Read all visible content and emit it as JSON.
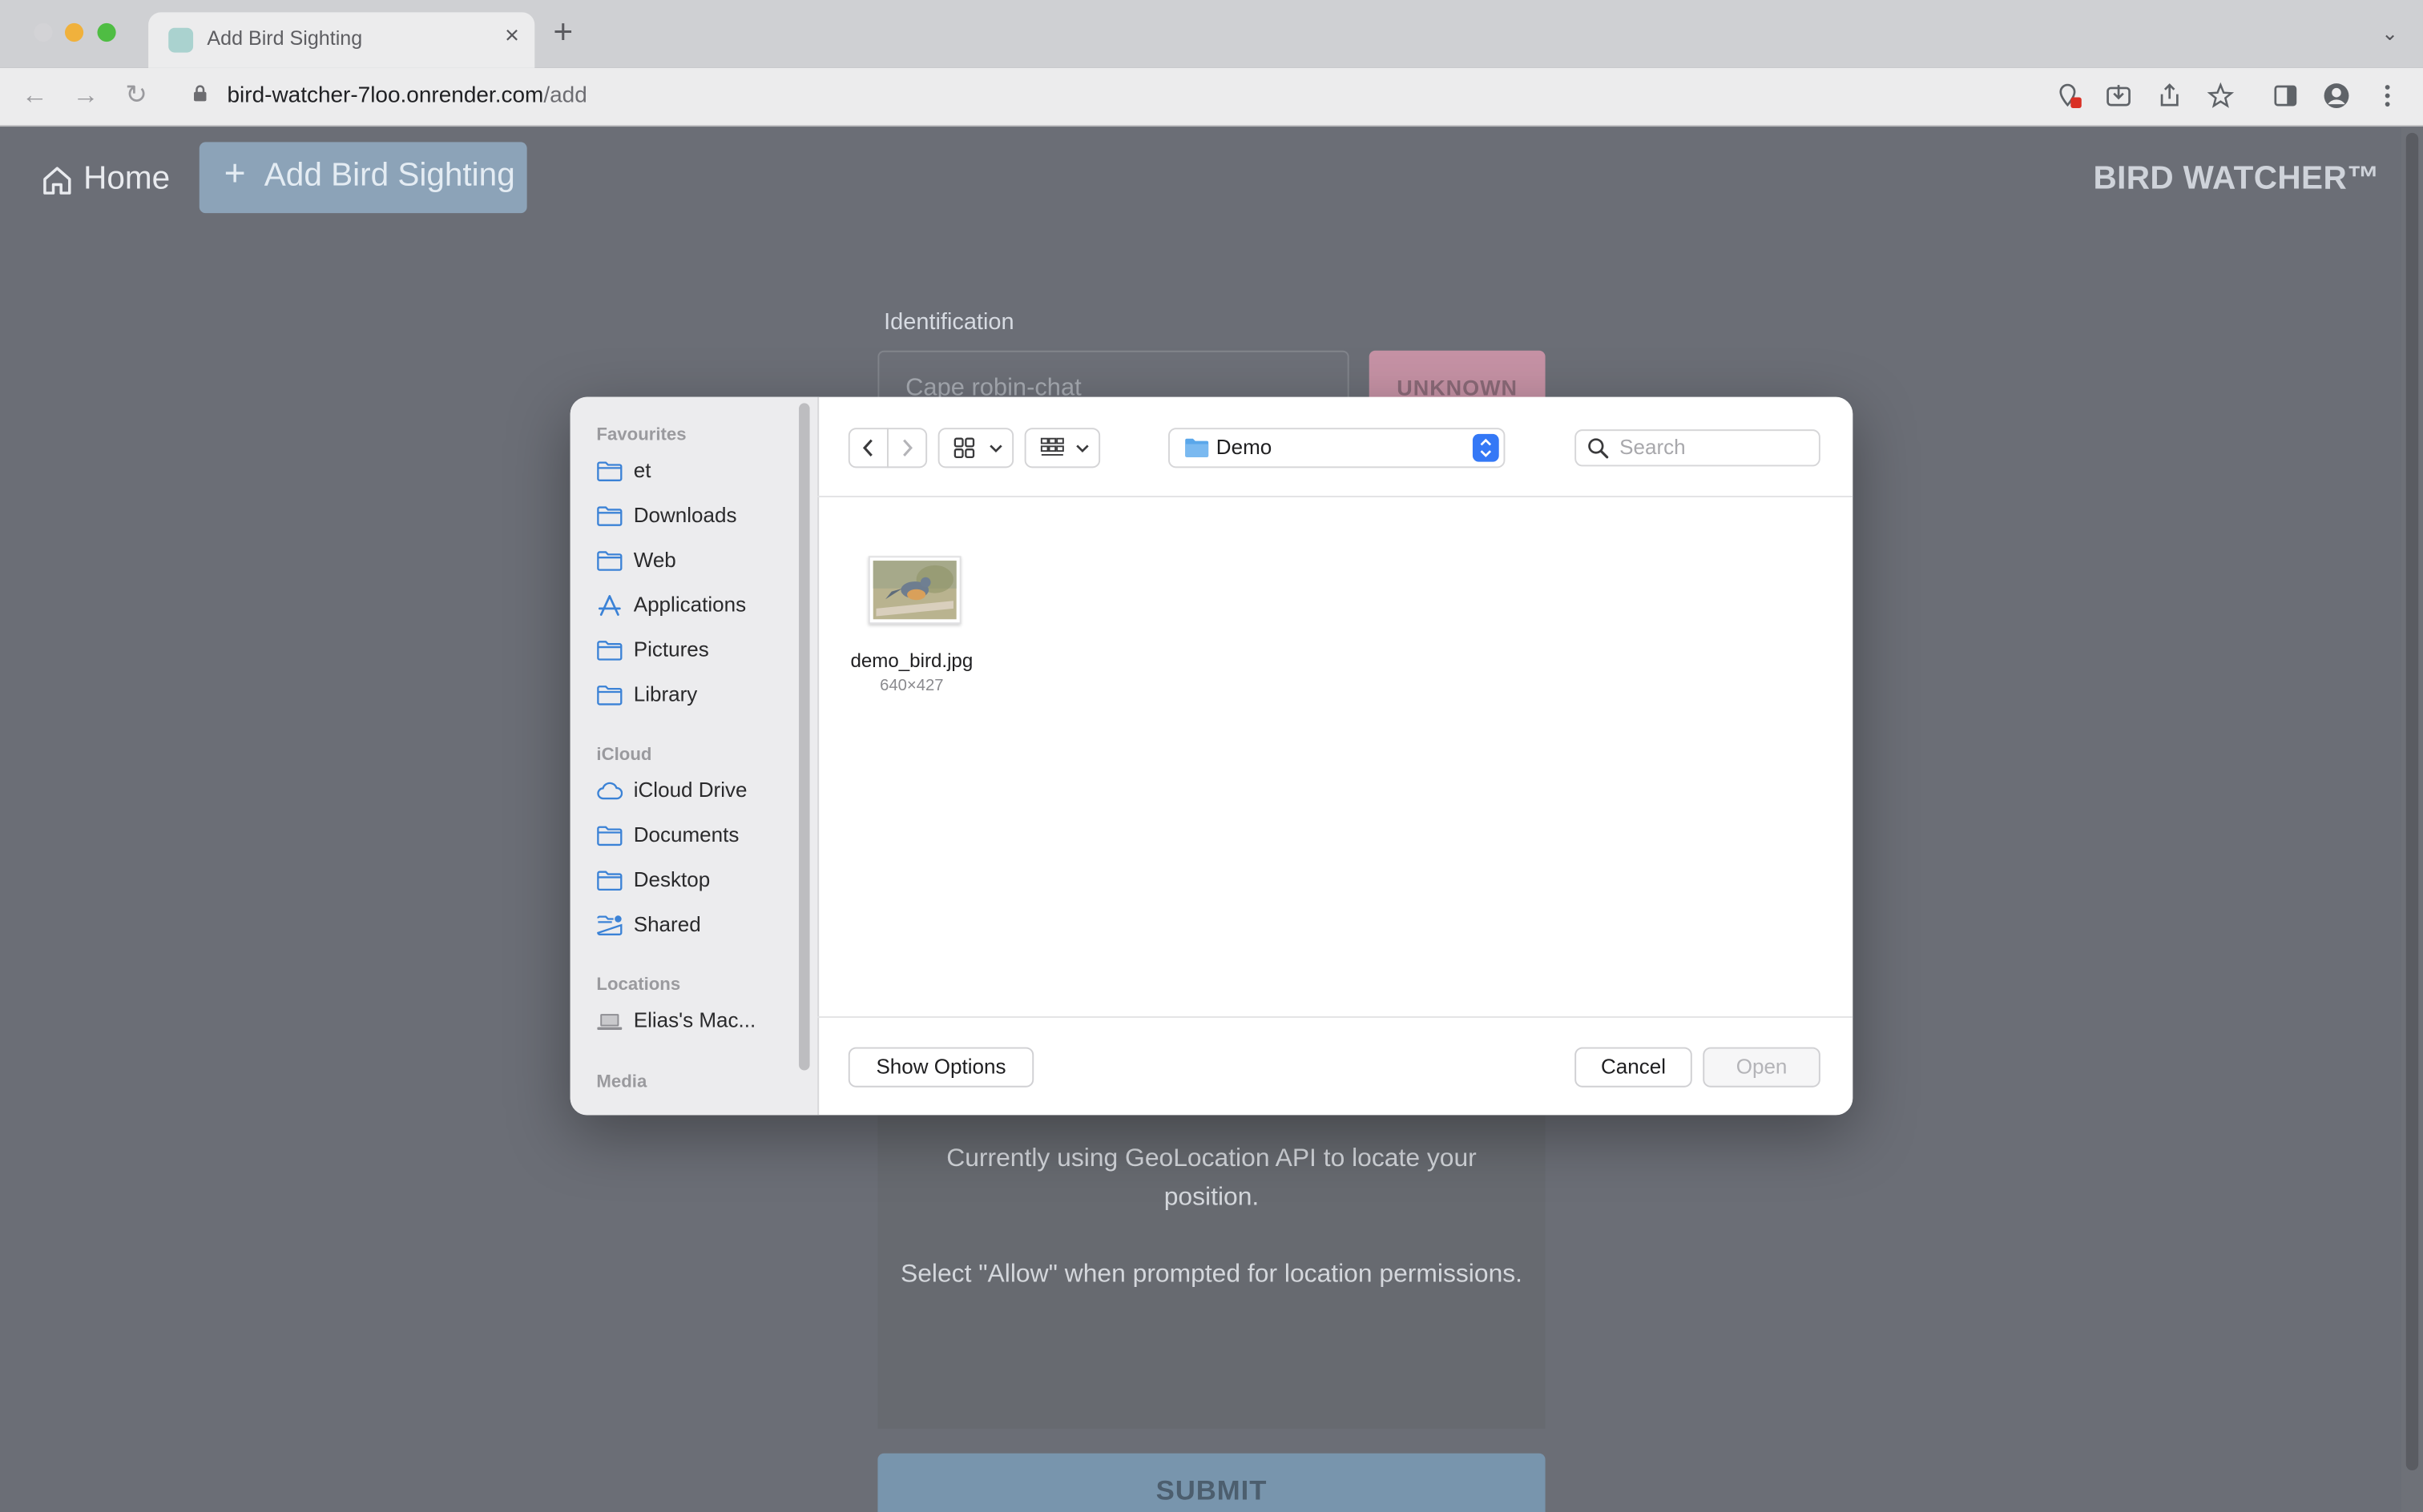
{
  "browser": {
    "tab_title": "Add Bird Sighting",
    "url_host": "bird-watcher-7loo.onrender.com",
    "url_path": "/add"
  },
  "app": {
    "home_label": "Home",
    "add_label": "Add Bird Sighting",
    "brand": "BIRD WATCHER™",
    "identification_label": "Identification",
    "identification_value": "Cape robin-chat",
    "unknown_label": "UNKNOWN",
    "geo_text_1": "Currently using GeoLocation API to locate your position.",
    "geo_text_2": "Select \"Allow\" when prompted for location permissions.",
    "submit_label": "SUBMIT"
  },
  "dialog": {
    "sidebar": {
      "favourites_header": "Favourites",
      "favourites": [
        {
          "label": "et",
          "icon": "folder-icon"
        },
        {
          "label": "Downloads",
          "icon": "folder-icon"
        },
        {
          "label": "Web",
          "icon": "folder-icon"
        },
        {
          "label": "Applications",
          "icon": "applications-icon"
        },
        {
          "label": "Pictures",
          "icon": "folder-icon"
        },
        {
          "label": "Library",
          "icon": "folder-icon"
        }
      ],
      "icloud_header": "iCloud",
      "icloud": [
        {
          "label": "iCloud Drive",
          "icon": "cloud-icon"
        },
        {
          "label": "Documents",
          "icon": "folder-icon"
        },
        {
          "label": "Desktop",
          "icon": "folder-icon"
        },
        {
          "label": "Shared",
          "icon": "shared-folder-icon"
        }
      ],
      "locations_header": "Locations",
      "locations": [
        {
          "label": "Elias's Mac...",
          "icon": "laptop-icon"
        }
      ],
      "media_header": "Media"
    },
    "current_folder": "Demo",
    "search_placeholder": "Search",
    "files": [
      {
        "name": "demo_bird.jpg",
        "dimensions": "640×427"
      }
    ],
    "show_options_label": "Show Options",
    "cancel_label": "Cancel",
    "open_label": "Open"
  },
  "colors": {
    "accent": "#3478f6",
    "folder_icon": "#3b82d6"
  }
}
